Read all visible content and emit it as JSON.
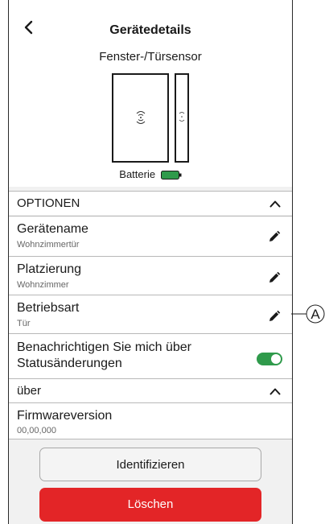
{
  "header": {
    "back_icon": "chevron-left-icon",
    "title": "Gerätedetails",
    "device_name": "Fenster-/Türsensor",
    "battery_label": "Batterie",
    "battery_icon": "battery-full-icon",
    "battery_color": "#2f9a4b"
  },
  "options": {
    "section_label": "OPTIONEN",
    "items": [
      {
        "label": "Gerätename",
        "value": "Wohnzimmertür",
        "icon": "edit-pencil-icon"
      },
      {
        "label": "Platzierung",
        "value": "Wohnzimmer",
        "icon": "edit-pencil-icon"
      },
      {
        "label": "Betriebsart",
        "value": "Tür",
        "icon": "edit-pencil-icon"
      }
    ],
    "notify": {
      "label_line1": "Benachrichtigen Sie mich über",
      "label_line2": "Statusänderungen",
      "enabled": true,
      "toggle_color": "#2f9a4b"
    }
  },
  "about": {
    "section_label": "über",
    "firmware_label": "Firmwareversion",
    "firmware_value": "00,00,000"
  },
  "buttons": {
    "identify": "Identifizieren",
    "delete": "Löschen",
    "delete_color": "#e32527"
  },
  "callout": {
    "letter": "A"
  }
}
